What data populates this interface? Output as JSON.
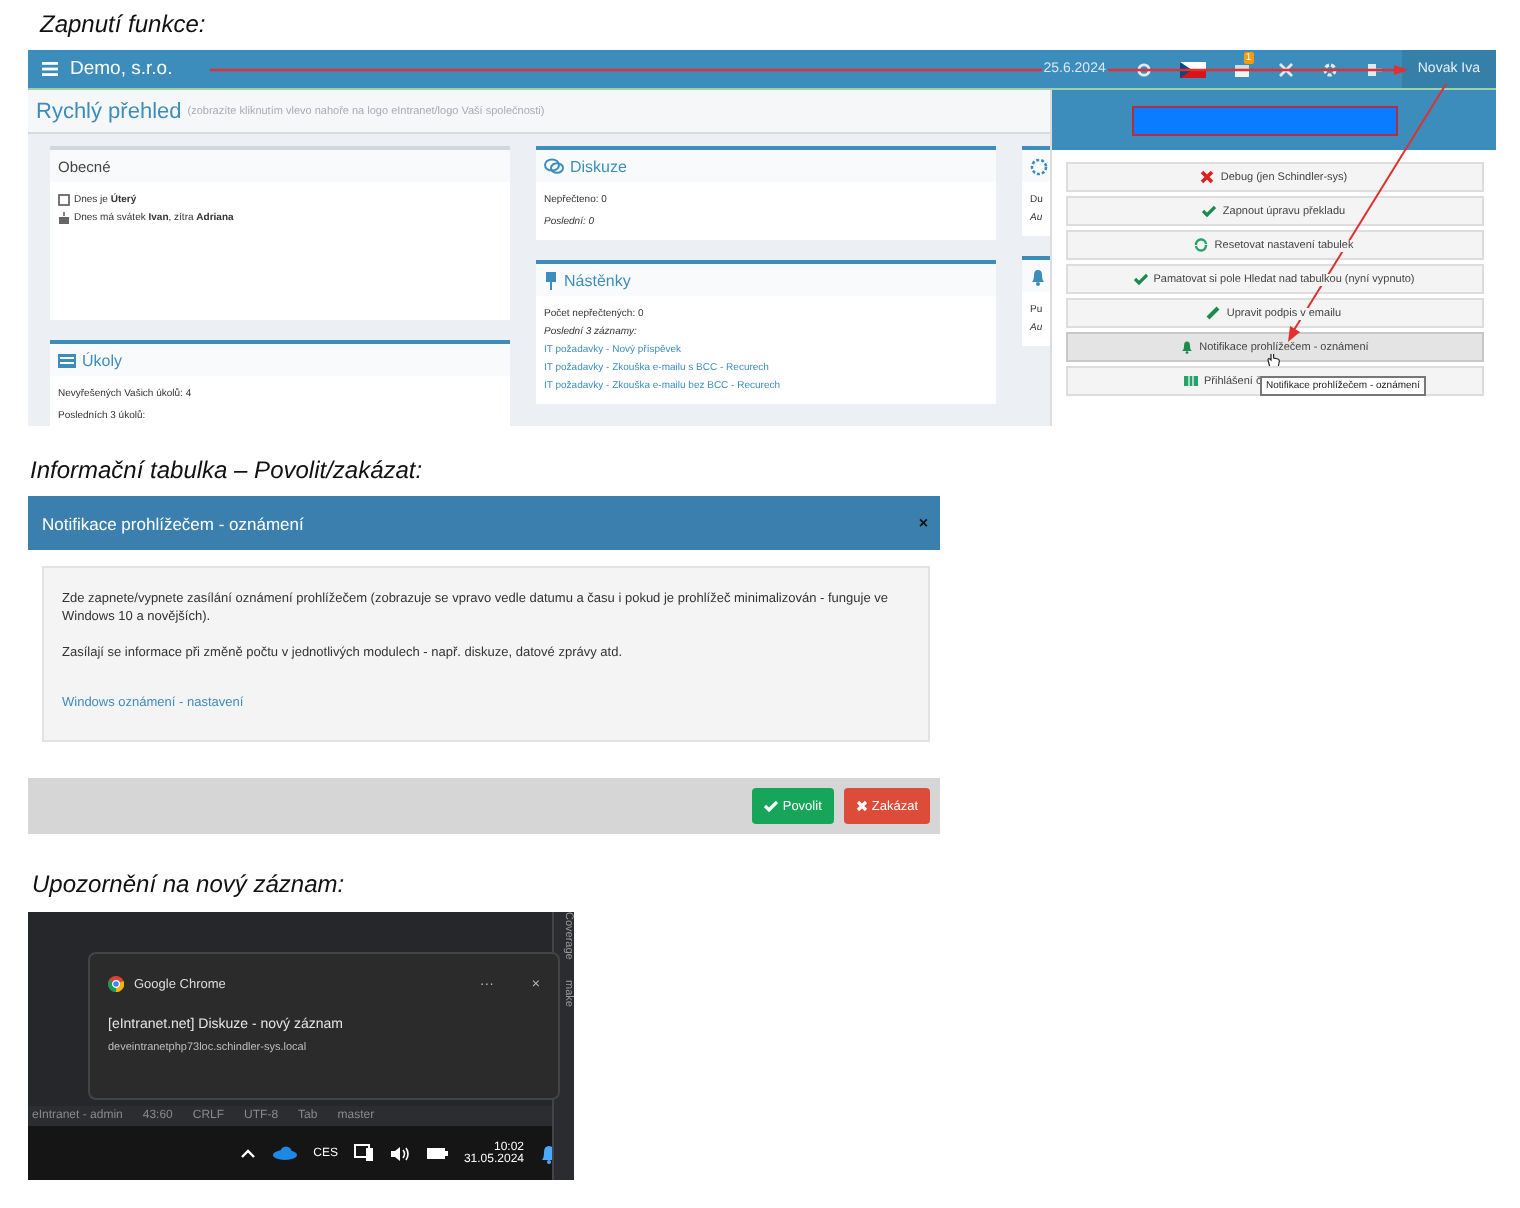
{
  "captions": [
    "Zapnutí funkce:",
    "Informační tabulka – Povolit/zakázat:",
    "Upozornění na nový záznam:"
  ],
  "app": {
    "company": "Demo, s.r.o.",
    "date": "25.6.2024",
    "badge": "1",
    "user": "Novak Iva",
    "page_title": "Rychlý přehled",
    "page_hint": "(zobrazíte kliknutím vlevo nahoře na logo eIntranet/logo Vaší společnosti)",
    "columns": [
      [
        {
          "title": "Obecné",
          "lines": [
            {
              "kind": "plain",
              "text": "Dnes je **Úterý**"
            },
            {
              "kind": "plain",
              "text": "Dnes má svátek **Ivan**, zítra **Adriana**"
            }
          ]
        },
        {
          "title": "Úkoly",
          "lines": [
            {
              "kind": "plain",
              "text": "Nevyřešených Vašich úkolů: 4"
            },
            {
              "kind": "plain",
              "text": "Posledních 3 úkolů:"
            }
          ]
        }
      ],
      [
        {
          "title": "Diskuze",
          "lines": [
            {
              "kind": "plain",
              "text": "Nepřečteno: 0"
            },
            {
              "kind": "note",
              "text": "Poslední: 0"
            }
          ]
        },
        {
          "title": "Nástěnky",
          "lines": [
            {
              "kind": "plain",
              "text": "Počet nepřečtených: 0"
            },
            {
              "kind": "note",
              "text": "Poslední 3 záznamy:"
            },
            {
              "kind": "link",
              "text": "IT požadavky - Nový příspěvek"
            },
            {
              "kind": "link",
              "text": "IT požadavky - Zkouška e-mailu s BCC - Recurech"
            },
            {
              "kind": "link",
              "text": "IT požadavky - Zkouška e-mailu bez BCC - Recurech"
            }
          ]
        }
      ],
      [
        {
          "lines": [
            {
              "kind": "plain",
              "text": "Du"
            },
            {
              "kind": "note",
              "text": "Au"
            }
          ]
        },
        {
          "lines": [
            {
              "kind": "plain",
              "text": "Pu"
            },
            {
              "kind": "note",
              "text": "Au"
            }
          ]
        }
      ]
    ],
    "menu": [
      {
        "label": "Debug (jen Schindler-sys)",
        "selected": false
      },
      {
        "label": "Zapnout úpravu překladu",
        "selected": false
      },
      {
        "label": "Resetovat nastavení tabulek",
        "selected": false
      },
      {
        "label": "Pamatovat si pole Hledat nad tabulkou (nyní vypnuto)",
        "selected": false
      },
      {
        "label": "Upravit podpis v emailu",
        "selected": false
      },
      {
        "label": "Notifikace prohlížečem - oznámení",
        "selected": true
      },
      {
        "label": "Přihlášení č",
        "selected": false
      }
    ],
    "tooltip": "Notifikace prohlížečem - oznámení"
  },
  "dialog": {
    "title": "Notifikace prohlížečem - oznámení",
    "close": "×",
    "paragraphs": [
      "Zde zapnete/vypnete zasílání oznámení prohlížečem (zobrazuje se vpravo vedle datumu a času i pokud je prohlížeč minimalizován - funguje ve Windows 10 a novějších).",
      "Zasílají se informace při změně počtu v jednotlivých modulech - např. diskuze, datové zprávy atd."
    ],
    "link": "Windows oznámení - nastavení",
    "buttons": [
      {
        "label": "Povolit",
        "kind": "confirm"
      },
      {
        "label": "Zakázat",
        "kind": "danger"
      }
    ]
  },
  "toast": {
    "app": "Google Chrome",
    "more": "···",
    "close": "×",
    "title": "[eIntranet.net] Diskuze - nový záznam",
    "source": "deveintranetphp73loc.schindler-sys.local",
    "status_bar": [
      "eIntranet - admin",
      "43:60",
      "CRLF",
      "UTF-8",
      "Tab",
      "master"
    ],
    "side_labels": [
      "Coverage",
      "make"
    ],
    "language": "CES",
    "time": "10:02",
    "date": "31.05.2024"
  }
}
